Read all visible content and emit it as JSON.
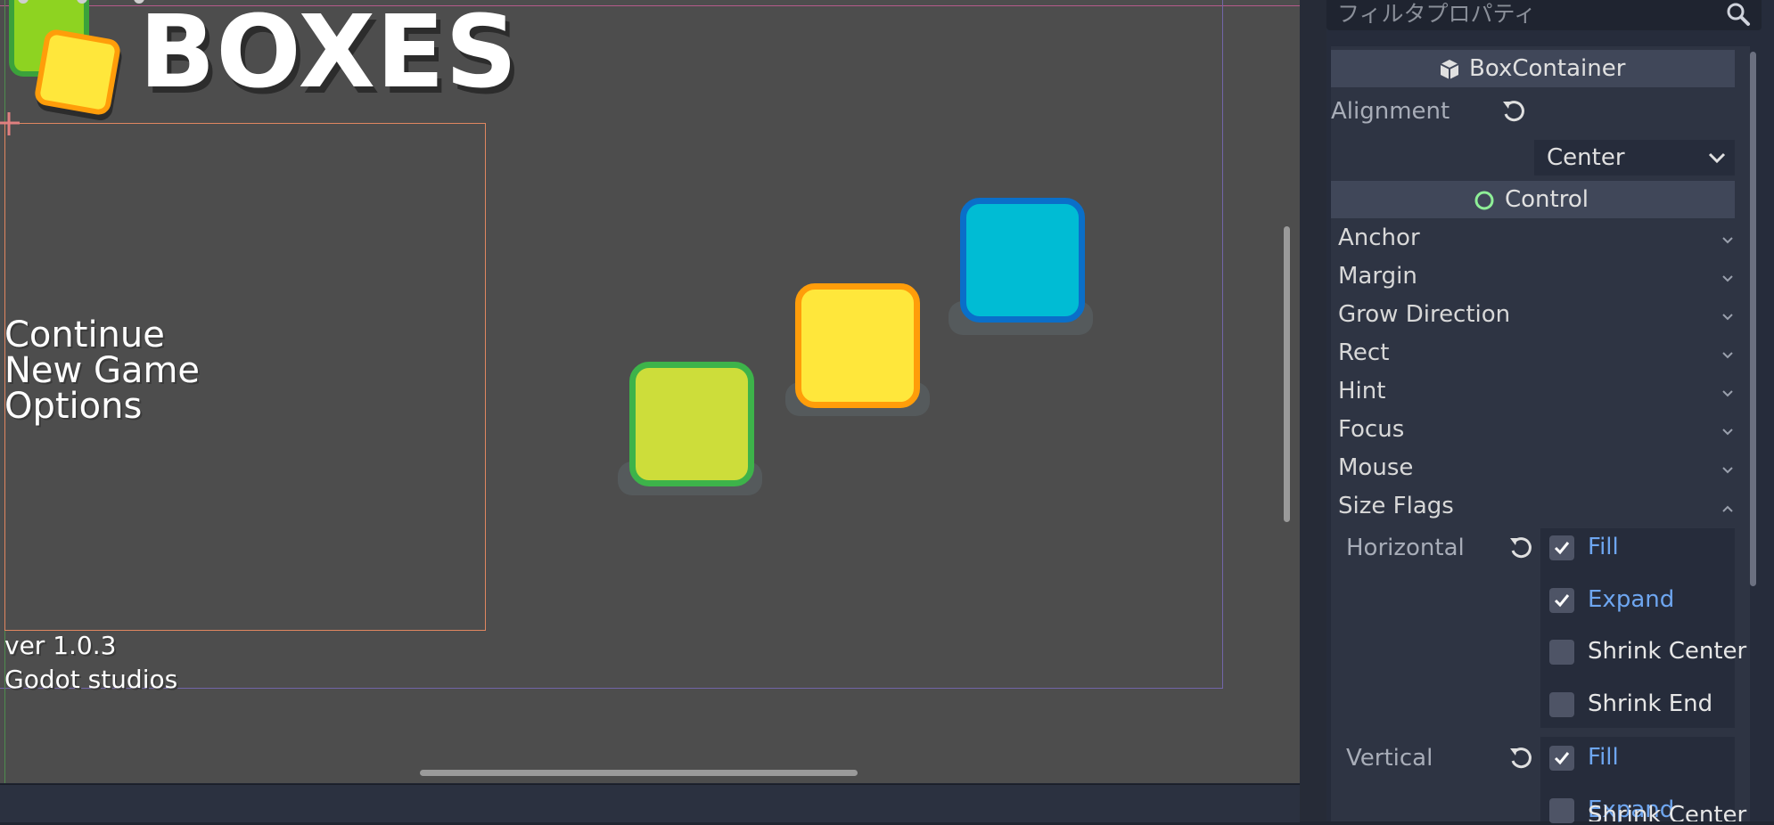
{
  "viewport": {
    "logo_text": "BOXES",
    "menu_items": [
      "Continue",
      "New Game",
      "Options"
    ],
    "version_line1": "ver 1.0.3",
    "version_line2": "Godot studios",
    "box_colors": {
      "green_fill": "#cddd3a",
      "green_border": "#3db34a",
      "yellow_fill": "#ffe73b",
      "yellow_border": "#ff9d0a",
      "cyan_fill": "#00bcd4",
      "cyan_border": "#0a6fc9"
    }
  },
  "inspector": {
    "filter_placeholder": "フィルタプロパティ",
    "box_container_title": "BoxContainer",
    "alignment_label": "Alignment",
    "alignment_value": "Center",
    "control_title": "Control",
    "groups": [
      "Anchor",
      "Margin",
      "Grow Direction",
      "Rect",
      "Hint",
      "Focus",
      "Mouse",
      "Size Flags"
    ],
    "size_flags": {
      "horizontal_label": "Horizontal",
      "vertical_label": "Vertical",
      "horizontal": [
        {
          "label": "Fill",
          "checked": true
        },
        {
          "label": "Expand",
          "checked": true
        },
        {
          "label": "Shrink Center",
          "checked": false
        },
        {
          "label": "Shrink End",
          "checked": false
        }
      ],
      "vertical": [
        {
          "label": "Fill",
          "checked": true
        },
        {
          "label": "Expand",
          "checked": true
        },
        {
          "label": "Shrink Center",
          "checked": false
        }
      ]
    }
  }
}
